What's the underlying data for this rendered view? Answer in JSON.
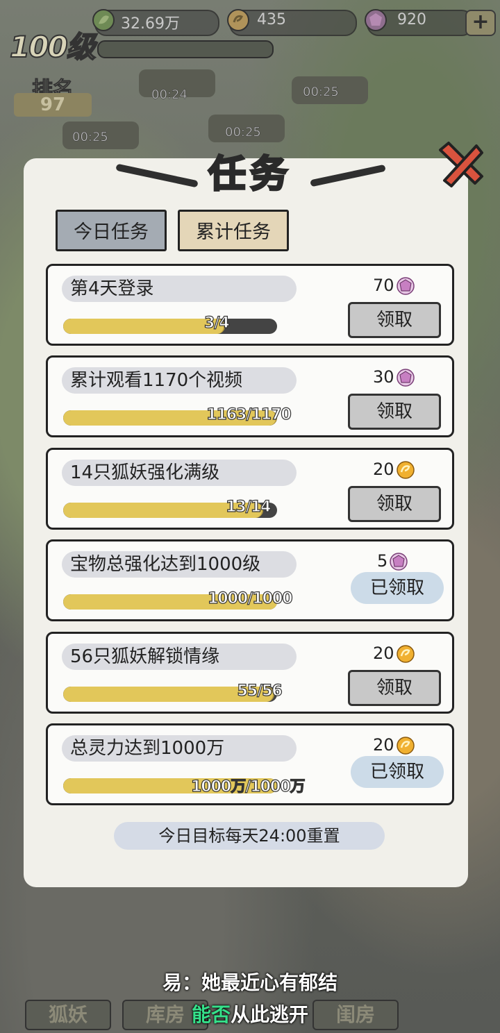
{
  "hud": {
    "leaf_amount": "32.69万",
    "coin_amount": "435",
    "gem_amount": "920",
    "plus_label": "+",
    "level_label": "100级",
    "rank_label": "排名",
    "rank_value": "97"
  },
  "background_timers": [
    "00:24",
    "00:25",
    "00:25",
    "00:25"
  ],
  "panel": {
    "title": "任务",
    "tabs": [
      {
        "label": "今日任务",
        "selected": false
      },
      {
        "label": "累计任务",
        "selected": true
      }
    ],
    "tasks": [
      {
        "name": "第4天登录",
        "progress_text": "3/4",
        "progress": 0.75,
        "reward_amount": "70",
        "reward_icon": "gem-icon",
        "status": "领取"
      },
      {
        "name": "累计观看1170个视频",
        "progress_text": "1163/1170",
        "progress": 0.994,
        "reward_amount": "30",
        "reward_icon": "gem-icon",
        "status": "领取"
      },
      {
        "name": "14只狐妖强化满级",
        "progress_text": "13/14",
        "progress": 0.929,
        "reward_amount": "20",
        "reward_icon": "coin-icon",
        "status": "领取"
      },
      {
        "name": "宝物总强化达到1000级",
        "progress_text": "1000/1000",
        "progress": 1.0,
        "reward_amount": "5",
        "reward_icon": "gem-icon",
        "status": "已领取"
      },
      {
        "name": "56只狐妖解锁情缘",
        "progress_text": "55/56",
        "progress": 0.982,
        "reward_amount": "20",
        "reward_icon": "coin-icon",
        "status": "领取"
      },
      {
        "name": "总灵力达到1000万",
        "progress_text": "1000万/1000万",
        "progress": 1.0,
        "reward_amount": "20",
        "reward_icon": "coin-icon",
        "status": "已领取"
      }
    ],
    "reset_note": "今日目标每天24:00重置"
  },
  "bottom_nav": [
    "狐妖",
    "库房",
    "闺房"
  ],
  "subtitle": {
    "line1": "易：她最近心有郁结",
    "line2_green": "能否",
    "line2_rest": "从此逃开"
  },
  "colors": {
    "progress_fill": "#e2c75a",
    "claim_button": "#c8c8c8",
    "claimed_badge": "#ccdbe8",
    "tab_selected": "#e4d6b8",
    "tab_unselected": "#a4abb3",
    "gem": "#c77fc2",
    "coin": "#f0b030",
    "close_x": "#d9533e",
    "subtitle_green": "#35e08a"
  }
}
